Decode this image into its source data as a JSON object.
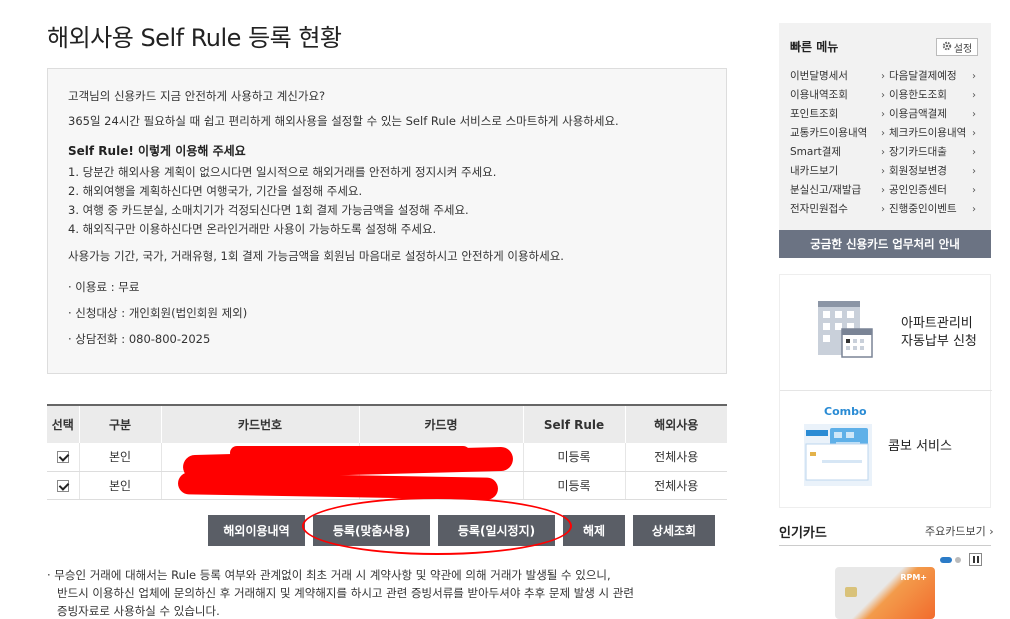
{
  "page": {
    "title": "해외사용 Self Rule 등록 현황"
  },
  "notice": {
    "intro_1": "고객님의 신용카드 지금 안전하게 사용하고 계신가요?",
    "intro_2": "365일 24시간 필요하실 때 쉽고 편리하게 해외사용을 설정할 수 있는 Self Rule 서비스로 스마트하게 사용하세요.",
    "how_title": "Self Rule! 이렇게 이용해 주세요",
    "steps": [
      "1. 당분간 해외사용 계획이 없으시다면 일시적으로 해외거래를 안전하게 정지시켜 주세요.",
      "2. 해외여행을 계획하신다면 여행국가, 기간을 설정해 주세요.",
      "3. 여행 중 카드분실, 소매치기가 걱정되신다면 1회 결제 가능금액을 설정해 주세요.",
      "4. 해외직구만 이용하신다면 온라인거래만 사용이 가능하도록 설정해 주세요."
    ],
    "summary": "사용가능 기간, 국가, 거래유형, 1회 결제 가능금액을 회원님 마음대로 설정하시고 안전하게 이용하세요.",
    "fee": "· 이용료 : 무료",
    "target": "· 신청대상 : 개인회원(법인회원 제외)",
    "phone": "· 상담전화 : 080-800-2025"
  },
  "table": {
    "headers": [
      "선택",
      "구분",
      "카드번호",
      "카드명",
      "Self Rule",
      "해외사용"
    ],
    "rows": [
      {
        "checked": true,
        "type": "본인",
        "card_no": "",
        "card_name": "",
        "self_rule": "미등록",
        "overseas": "전체사용"
      },
      {
        "checked": true,
        "type": "본인",
        "card_no": "",
        "card_name": "",
        "self_rule": "미등록",
        "overseas": "전체사용"
      }
    ]
  },
  "buttons": {
    "history": "해외이용내역",
    "register_custom": "등록(맞춤사용)",
    "register_pause": "등록(일시정지)",
    "cancel": "해제",
    "detail": "상세조회"
  },
  "footnote": {
    "line_1": "· 무승인 거래에 대해서는 Rule 등록 여부와 관계없이 최초 거래 시 계약사항 및 약관에 의해 거래가 발생될 수 있으니,",
    "line_2": "반드시 이용하신 업체에 문의하신 후 거래해지 및 계약해지를 하시고 관련 증빙서류를 받아두셔야 추후 문제 발생 시 관련",
    "line_3": "증빙자료로 사용하실 수 있습니다."
  },
  "quick_menu": {
    "title": "빠른 메뉴",
    "settings_label": "설정",
    "items": [
      "이번달명세서",
      "다음달결제예정",
      "이용내역조회",
      "이용한도조회",
      "포인트조회",
      "이용금액결제",
      "교통카드이용내역",
      "체크카드이용내역",
      "Smart결제",
      "장기카드대출",
      "내카드보기",
      "회원정보변경",
      "분실신고/재발급",
      "공인인증센터",
      "전자민원접수",
      "진행중인이벤트"
    ],
    "arrow": "›",
    "banner": "궁금한 신용카드 업무처리 안내"
  },
  "promos": {
    "apt_line_1": "아파트관리비",
    "apt_line_2": "자동납부 신청",
    "combo_logo": "Combo",
    "combo_label": "콤보 서비스"
  },
  "popular": {
    "title": "인기카드",
    "more": "주요카드보기 ›",
    "card_brand": "RPM+"
  },
  "colors": {
    "button_bg": "#5a5e66",
    "banner_bg": "#6b7383",
    "redaction": "#ff0000",
    "combo_blue": "#2a8bd4"
  }
}
